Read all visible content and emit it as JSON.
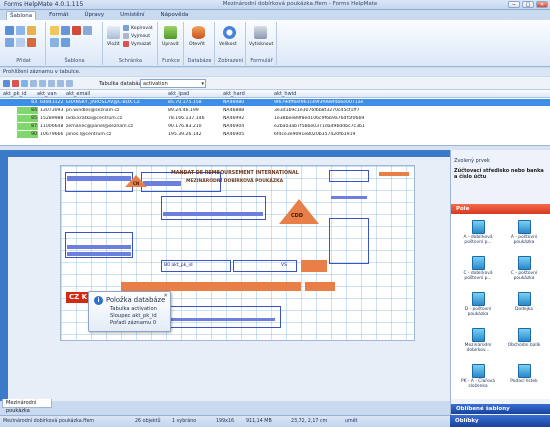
{
  "window": {
    "app_title": "Forms HelpMate 4.0.1.115",
    "doc_title": "Mezinárodní dobírková poukázka.ffem - Forms HelpMate",
    "min": "−",
    "max": "□",
    "close": "✕"
  },
  "menu": [
    "Šablona",
    "Formát",
    "Úpravy",
    "Umístění",
    "Nápověda"
  ],
  "ribbon": {
    "groups": {
      "pridat": "Přidat",
      "sablona": "Šablona",
      "schranka": "Schránka",
      "funkce": "Funkce",
      "databaze": "Databáze",
      "zobrazeni": "Zobrazení",
      "formular": "Formulář"
    },
    "buttons": {
      "vlozit": "Vložit",
      "kopirovat": "Kopírovat",
      "vyjmout": "Vyjmout",
      "vymazat": "Vymazat",
      "upravit": "Upravit",
      "otevrit": "Otevřít",
      "velikost": "Velikost",
      "vytisknout": "Vytisknout"
    }
  },
  "breadcrumb": "Prohlížení záznamu v tabulce.",
  "table_picker": {
    "label": "Tabulka databáze:",
    "value": "activation"
  },
  "grid": {
    "columns": [
      "akt_pk_id",
      "akt_van",
      "akt_email",
      "akt_ipad",
      "akt_hard",
      "akt_hwid"
    ],
    "rows": [
      {
        "id": "83",
        "van": "64843122",
        "email": "EHANSKY, JAROSLAV@C-BOX.CZ",
        "ip": "85.70.175.158",
        "hard": "NA46980",
        "hwid": "9f679dff6ef961c49f3f989f4b6e0071ae",
        "selected": true
      },
      {
        "id": "84",
        "van": "13073093",
        "email": "pn.windles@seznam.cz",
        "ip": "89.24.46.199",
        "hard": "NA46888",
        "hwid": "3e3d1b9c1e3076fbb8f3270c45cf1ff7",
        "selected": false
      },
      {
        "id": "85",
        "van": "15289988",
        "email": "lada.kratka@centrum.cz",
        "ip": "78.166.137.146",
        "hard": "NA46992",
        "hwid": "1e38bee89f8ed106c9f6b9a76df5f06b9",
        "selected": false
      },
      {
        "id": "87",
        "van": "11006648",
        "email": "zemanec@panel@seznam.cz",
        "ip": "90.176.83.210",
        "hard": "NA46904",
        "hwid": "e2ba03ab7f5bbe0371da49bddbc7c3b1",
        "selected": false
      },
      {
        "id": "90",
        "van": "10679666",
        "email": "janos.l@centrum.cz",
        "ip": "195.39.26.142",
        "hard": "NA46905",
        "hwid": "6f4ce3e9091e8020b357420fb1919",
        "selected": false
      }
    ]
  },
  "form": {
    "heading1": "MANDAT DE REMBOURSEMENT INTERNATIONAL",
    "heading2": "MEZINÁRODNÍ DOBÍRKOVÁ POUKÁZKA",
    "badge_left": "CN",
    "badge_right": "CDD",
    "field_label": "B0 akt_pk_id",
    "vs_label": "VS",
    "czk": "CZ K"
  },
  "tooltip": {
    "title": "Položka databáze",
    "line1": "Tabulka activation",
    "line2": "Sloupec akt_pk_id",
    "line3": "Pořadí záznamu 0",
    "close": "✕"
  },
  "doc_tab": "Mezinárodní poukázka",
  "status": {
    "file": "Mezinárodní dobírková poukázka.ffem",
    "objects": "26 objektů",
    "selected": "1 vybráno",
    "size": "199x16",
    "pos": "911,14 MB",
    "coords": "23,72, 2,17 cm",
    "mode": "umět"
  },
  "right_pane": {
    "header": "Zvolený prvek",
    "description": "Zúčtovací středisko nebo banka a číslo účtu",
    "section_pole": "Pole",
    "shapes": [
      "A - dobírková poštovní p...",
      "A - poštovní poukázka",
      "C - dobírková poštovní p...",
      "C - poštovní poukázka",
      "D - poštovní poukázka",
      "Dodejka",
      "Mezinárodní dobírkov...",
      "Obchodní balík",
      "PK - A - Clařová složenka",
      "Podací lístek"
    ],
    "section_oblibene": "Oblíbené šablony",
    "section_oblibky": "Oblíbky"
  },
  "colors": {
    "accent_blue": "#3d8ee6",
    "form_orange": "#e87f48",
    "form_blue": "#3a54c6",
    "id_green": "#7ed86b",
    "czk_red": "#d42a13"
  }
}
